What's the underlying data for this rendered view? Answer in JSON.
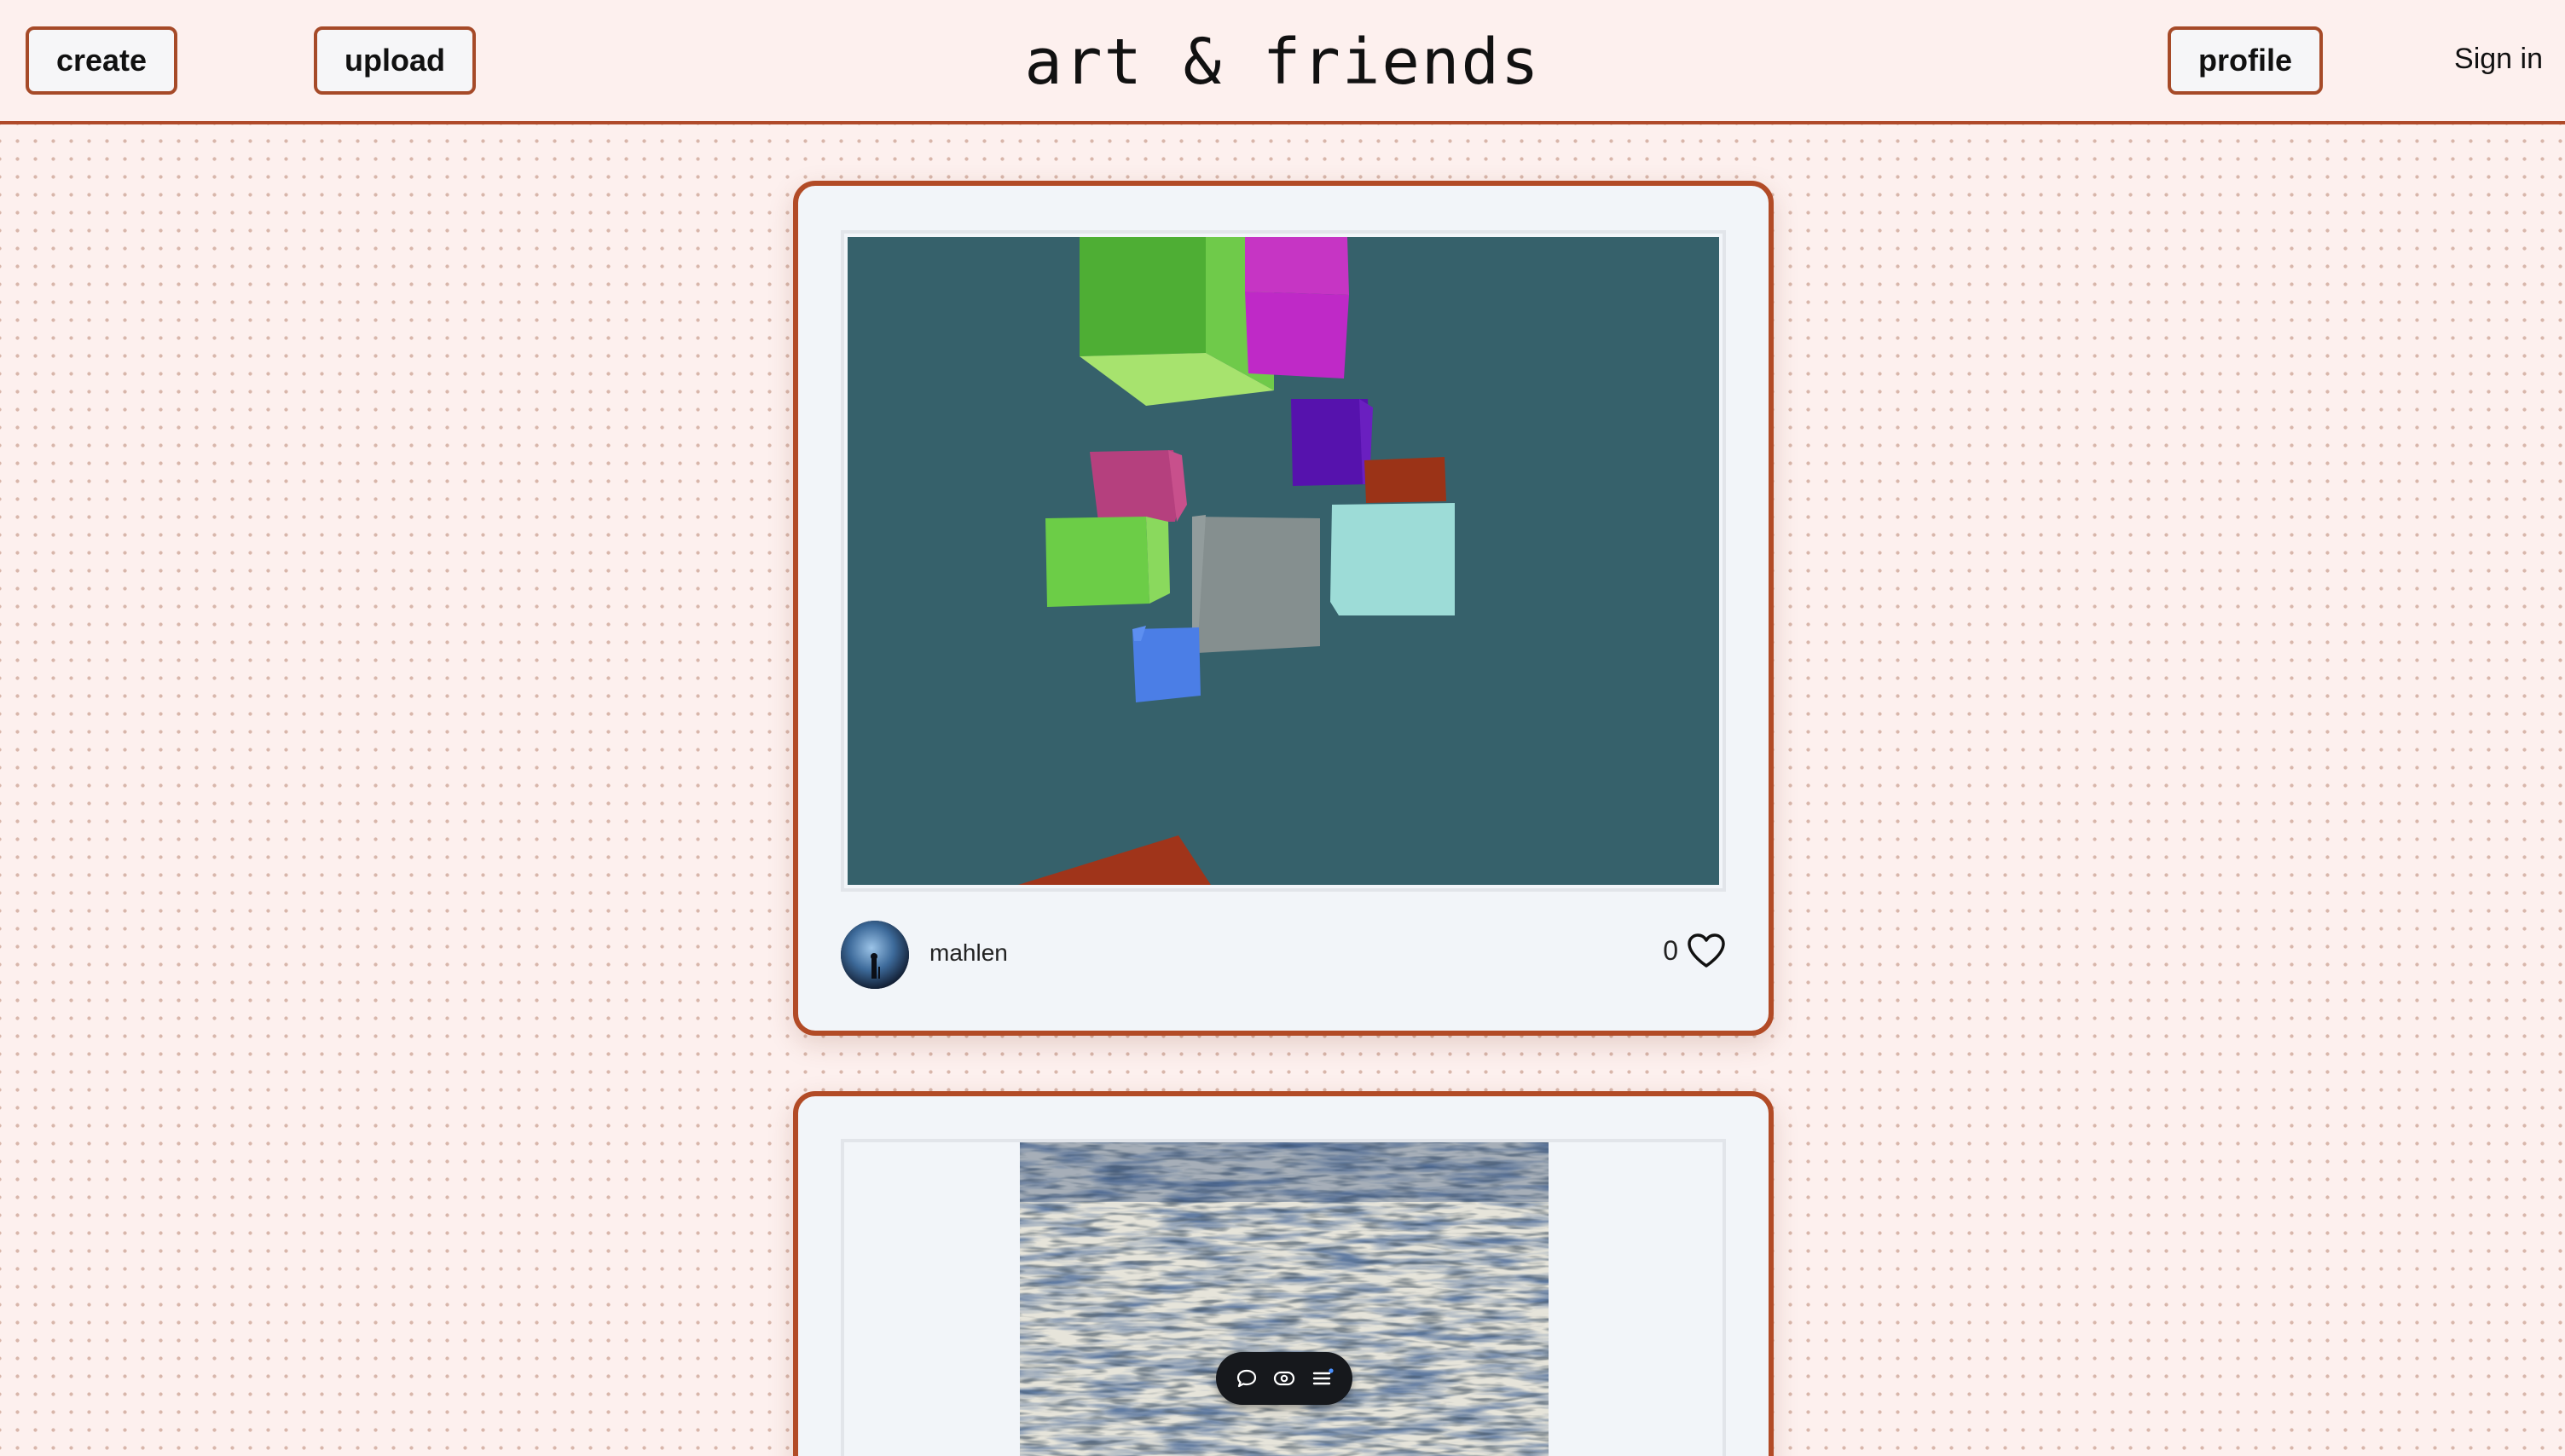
{
  "header": {
    "create_label": "create",
    "upload_label": "upload",
    "site_title": "art & friends",
    "profile_label": "profile",
    "sign_in_label": "Sign in"
  },
  "theme": {
    "accent": "#b24b26",
    "background": "#fdf0ee",
    "card_background": "#f2f5f9",
    "canvas_background": "#36616b"
  },
  "posts": [
    {
      "artwork": "3d-cubes-scene",
      "author": "mahlen",
      "likes": "0",
      "like_icon": "heart-icon",
      "avatar_icon": "avatar-silhouette"
    },
    {
      "artwork": "blue-abstract-painting"
    }
  ],
  "floating_toolbar": {
    "icons": [
      "comment-icon",
      "eye-icon",
      "menu-icon"
    ]
  }
}
